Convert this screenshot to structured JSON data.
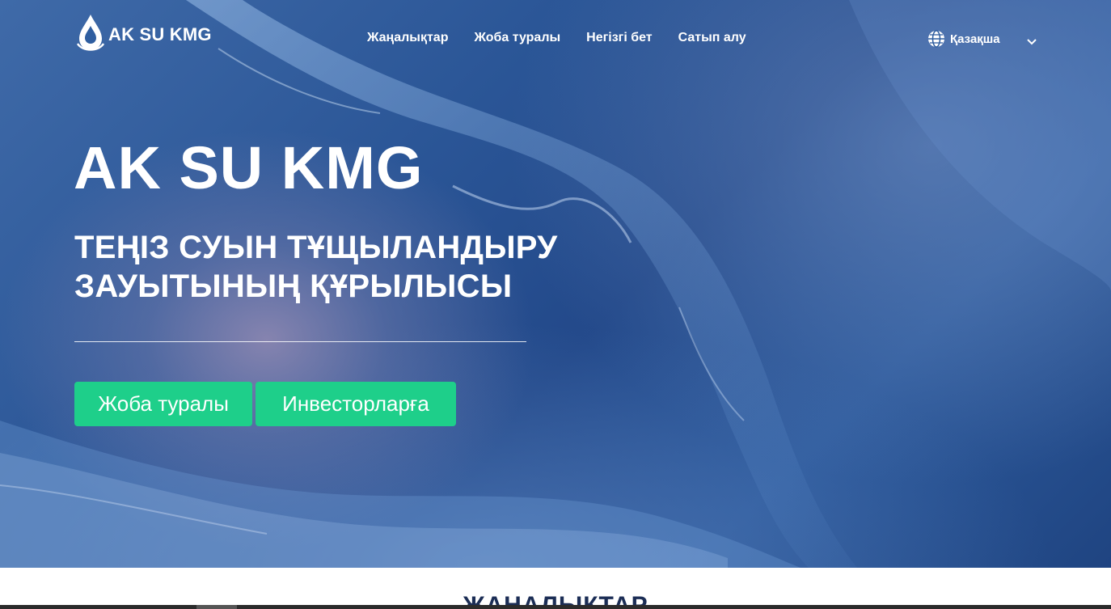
{
  "brand": {
    "name": "AK SU KMG"
  },
  "nav": {
    "items": [
      {
        "label": "Жаңалықтар"
      },
      {
        "label": "Жоба туралы"
      },
      {
        "label": "Негізгі бет"
      },
      {
        "label": "Сатып алу"
      }
    ],
    "language": "Қазақша"
  },
  "hero": {
    "title": "AK SU KMG",
    "subtitle": "ТЕҢІЗ СУЫН ТҰЩЫЛАНДЫРУ ЗАУЫТЫНЫҢ ҚҰРЫЛЫСЫ",
    "buttons": [
      {
        "label": "Жоба туралы"
      },
      {
        "label": "Инвесторларға"
      }
    ]
  },
  "news": {
    "title": "ЖАҢАЛЫҚТАР"
  },
  "colors": {
    "accent": "#1ecf8a",
    "heading": "#1b2d55",
    "hero_bg": "#2a5596"
  },
  "icons": {
    "logo": "water-drop-icon",
    "language": "globe-icon",
    "dropdown": "chevron-down-icon"
  }
}
